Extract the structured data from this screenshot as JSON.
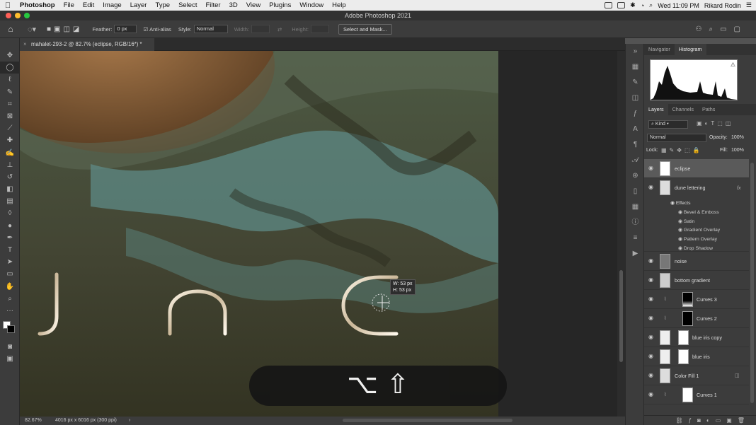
{
  "menubar": {
    "app_name": "Photoshop",
    "items": [
      "File",
      "Edit",
      "Image",
      "Layer",
      "Type",
      "Select",
      "Filter",
      "3D",
      "View",
      "Plugins",
      "Window",
      "Help"
    ],
    "clock": "Wed 11:09 PM",
    "user": "Rikard Rodin"
  },
  "window": {
    "title": "Adobe Photoshop 2021"
  },
  "options": {
    "feather_label": "Feather:",
    "feather_value": "0 px",
    "antialias_label": "Anti-alias",
    "style_label": "Style:",
    "style_value": "Normal",
    "width_label": "Width:",
    "height_label": "Height:",
    "select_mask_label": "Select and Mask..."
  },
  "document": {
    "tab_title": "mahalet-293-2 @ 82.7% (eclipse, RGB/16*) *",
    "zoom": "82.67%",
    "doc_info": "4016 px x 6016 px (300 ppi)"
  },
  "canvas": {
    "tooltip_w": "W: 53 px",
    "tooltip_h": "H: 53 px",
    "shortcut_keys": "⌥ ⇧"
  },
  "panels": {
    "top_tabs": [
      "Navigator",
      "Histogram"
    ],
    "layer_tabs": [
      "Layers",
      "Channels",
      "Paths"
    ],
    "kind_label": "Kind",
    "blend_mode": "Normal",
    "opacity_label": "Opacity:",
    "opacity_value": "100%",
    "lock_label": "Lock:",
    "fill_label": "Fill:",
    "fill_value": "100%"
  },
  "layers": [
    {
      "name": "eclipse"
    },
    {
      "name": "dune lettering"
    },
    {
      "name": "noise"
    },
    {
      "name": "bottom gradient"
    },
    {
      "name": "Curves 3"
    },
    {
      "name": "Curves 2"
    },
    {
      "name": "blue iris copy"
    },
    {
      "name": "blue iris"
    },
    {
      "name": "Color Fill 1"
    },
    {
      "name": "Curves 1"
    }
  ],
  "effects": {
    "header": "Effects",
    "items": [
      "Bevel & Emboss",
      "Satin",
      "Gradient Overlay",
      "Pattern Overlay",
      "Drop Shadow"
    ],
    "fx": "fx"
  },
  "colors": {
    "canvas_teal": "#5e8a85",
    "canvas_dark": "#3f4030",
    "ui_bg": "#3c3c3c"
  }
}
